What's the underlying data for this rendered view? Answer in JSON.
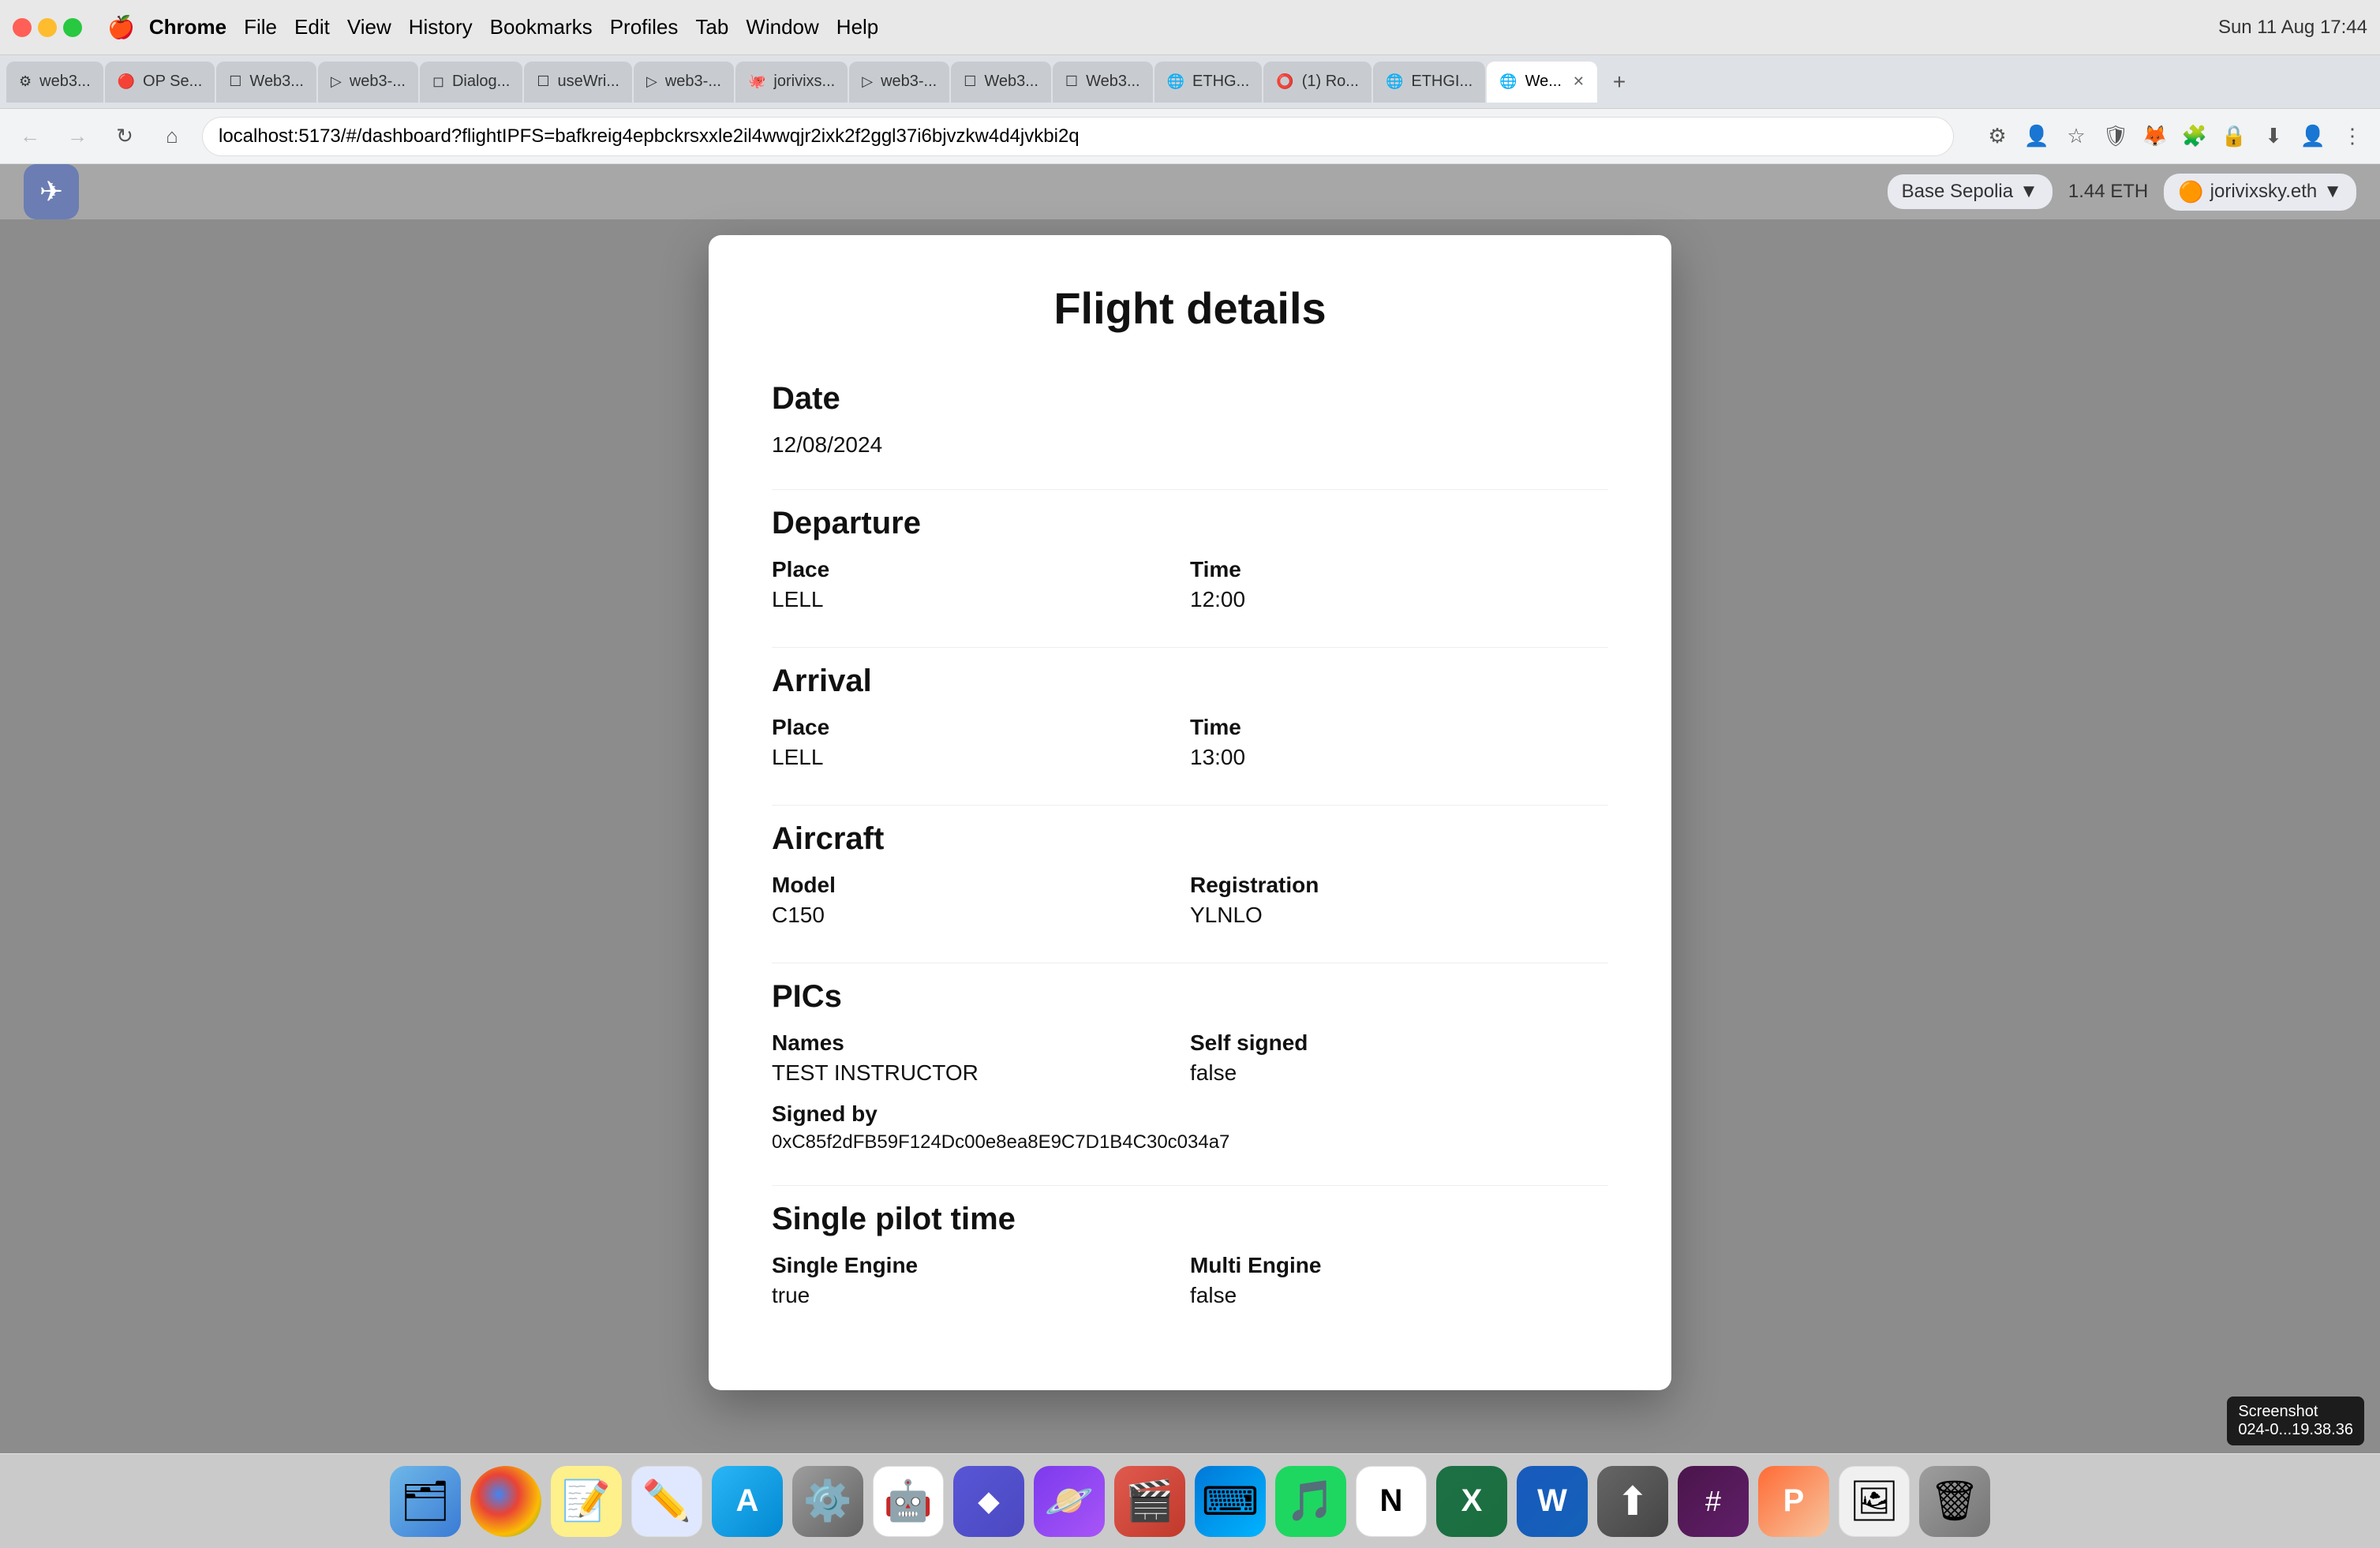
{
  "browser": {
    "title": "Chrome",
    "url": "localhost:5173/#/dashboard?flightIPFS=bafkreig4epbckrsxxle2il4wwqjr2ixk2f2ggl37i6bjvzkw4d4jvkbi2q",
    "tabs": [
      {
        "label": "web3...",
        "active": false,
        "id": "t1"
      },
      {
        "label": "OP Se...",
        "active": false,
        "id": "t2"
      },
      {
        "label": "Web3...",
        "active": false,
        "id": "t3"
      },
      {
        "label": "web3-...",
        "active": false,
        "id": "t4"
      },
      {
        "label": "Dialog...",
        "active": false,
        "id": "t5"
      },
      {
        "label": "useWri...",
        "active": false,
        "id": "t6"
      },
      {
        "label": "web3-...",
        "active": false,
        "id": "t7"
      },
      {
        "label": "jorivixs...",
        "active": false,
        "id": "t8"
      },
      {
        "label": "web3-...",
        "active": false,
        "id": "t9"
      },
      {
        "label": "Web3...",
        "active": false,
        "id": "t10"
      },
      {
        "label": "Web3...",
        "active": false,
        "id": "t11"
      },
      {
        "label": "ETHG...",
        "active": false,
        "id": "t12"
      },
      {
        "label": "(1) Ro...",
        "active": false,
        "id": "t13"
      },
      {
        "label": "ETHGI...",
        "active": false,
        "id": "t14"
      },
      {
        "label": "We...",
        "active": true,
        "id": "t15"
      }
    ],
    "menu_items": [
      "Chrome",
      "File",
      "Edit",
      "View",
      "History",
      "Bookmarks",
      "Profiles",
      "Tab",
      "Window",
      "Help"
    ],
    "time": "Sun 11 Aug 17:44"
  },
  "app_header": {
    "network": "Base Sepolia",
    "eth_amount": "1.44 ETH",
    "user": "jorivixsky.eth"
  },
  "modal": {
    "title": "Flight details",
    "sections": {
      "date": {
        "title": "Date",
        "value": "12/08/2024"
      },
      "departure": {
        "title": "Departure",
        "place_label": "Place",
        "place_value": "LELL",
        "time_label": "Time",
        "time_value": "12:00"
      },
      "arrival": {
        "title": "Arrival",
        "place_label": "Place",
        "place_value": "LELL",
        "time_label": "Time",
        "time_value": "13:00"
      },
      "aircraft": {
        "title": "Aircraft",
        "model_label": "Model",
        "model_value": "C150",
        "registration_label": "Registration",
        "registration_value": "YLNLO"
      },
      "pics": {
        "title": "PICs",
        "names_label": "Names",
        "names_value": "TEST INSTRUCTOR",
        "self_signed_label": "Self signed",
        "self_signed_value": "false",
        "signed_by_label": "Signed by",
        "signed_by_value": "0xC85f2dFB59F124Dc00e8ea8E9C7D1B4C30c034a7"
      },
      "single_pilot_time": {
        "title": "Single pilot time",
        "single_engine_label": "Single Engine",
        "single_engine_value": "true",
        "multi_engine_label": "Multi Engine",
        "multi_engine_value": "false"
      }
    }
  },
  "dock": {
    "items": [
      {
        "name": "finder",
        "emoji": "🗂"
      },
      {
        "name": "chrome",
        "emoji": "●"
      },
      {
        "name": "notes",
        "emoji": "📝"
      },
      {
        "name": "freeform",
        "emoji": "✏️"
      },
      {
        "name": "appstore",
        "emoji": "A"
      },
      {
        "name": "settings",
        "emoji": "⚙️"
      },
      {
        "name": "chatgpt",
        "emoji": "🤖"
      },
      {
        "name": "linear",
        "emoji": "◆"
      },
      {
        "name": "planet",
        "emoji": "🪐"
      },
      {
        "name": "keynote",
        "emoji": "🎬"
      },
      {
        "name": "vscode",
        "emoji": "⌨"
      },
      {
        "name": "spotify",
        "emoji": "♪"
      },
      {
        "name": "notion",
        "emoji": "N"
      },
      {
        "name": "excel",
        "emoji": "X"
      },
      {
        "name": "word",
        "emoji": "W"
      },
      {
        "name": "transloader",
        "emoji": "⬆"
      },
      {
        "name": "slack",
        "emoji": "#"
      },
      {
        "name": "proxyman",
        "emoji": "P"
      },
      {
        "name": "photos",
        "emoji": "🖼"
      },
      {
        "name": "trash",
        "emoji": "🗑"
      }
    ]
  },
  "screenshot_badge": "024-0...19.38.36"
}
